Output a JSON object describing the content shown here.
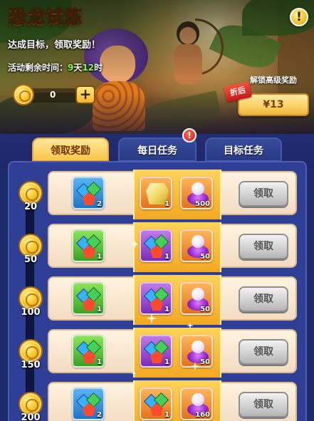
{
  "header": {
    "title": "恐龙试炼",
    "help_icon": "exclamation-icon",
    "help_label": "!",
    "subtitle": "达成目标，领取奖励！",
    "timer": {
      "prefix": "活动剩余时间：",
      "days": "9",
      "days_unit": "天",
      "hours": "12",
      "hours_unit": "时"
    },
    "coins": {
      "count": "0",
      "add_label": "+"
    },
    "unlock_label": "解锁高级奖励",
    "discount_tag": "折后",
    "price_label": "¥13"
  },
  "tabs": [
    {
      "label": "领取奖励",
      "active": true
    },
    {
      "label": "每日任务",
      "active": false,
      "badge": "!"
    },
    {
      "label": "目标任务",
      "active": false
    }
  ],
  "rewards": [
    {
      "milestone": "20",
      "free": {
        "icon": "gem-bundle-icon",
        "quality": "blue",
        "qty": "2"
      },
      "premium": [
        {
          "icon": "crystal-chest-icon",
          "quality": "orange",
          "qty": "1"
        },
        {
          "icon": "purple-orb-icon",
          "quality": "orange",
          "qty": "500"
        }
      ],
      "claim_label": "领取"
    },
    {
      "milestone": "50",
      "free": {
        "icon": "gem-bundle-icon",
        "quality": "green",
        "qty": "1"
      },
      "premium": [
        {
          "icon": "gem-bundle-icon",
          "quality": "purple",
          "qty": "1"
        },
        {
          "icon": "purple-orb-icon",
          "quality": "orange",
          "qty": "50"
        }
      ],
      "claim_label": "领取"
    },
    {
      "milestone": "100",
      "free": {
        "icon": "gem-bundle-icon",
        "quality": "green",
        "qty": "1"
      },
      "premium": [
        {
          "icon": "gem-bundle-icon",
          "quality": "purple",
          "qty": "1"
        },
        {
          "icon": "purple-orb-icon",
          "quality": "orange",
          "qty": "50"
        }
      ],
      "claim_label": "领取"
    },
    {
      "milestone": "150",
      "free": {
        "icon": "gem-bundle-icon",
        "quality": "green",
        "qty": "1"
      },
      "premium": [
        {
          "icon": "gem-bundle-icon",
          "quality": "purple",
          "qty": "1"
        },
        {
          "icon": "purple-orb-icon",
          "quality": "orange",
          "qty": "50"
        }
      ],
      "claim_label": "领取"
    },
    {
      "milestone": "200",
      "free": {
        "icon": "gem-bundle-icon",
        "quality": "blue",
        "qty": "2"
      },
      "premium": [
        {
          "icon": "gem-bundle-icon",
          "quality": "orange",
          "qty": "1"
        },
        {
          "icon": "purple-orb-icon",
          "quality": "orange",
          "qty": "160"
        }
      ],
      "claim_label": "领取"
    }
  ],
  "colors": {
    "background": "#1f2a6b",
    "title": "#ffe27a",
    "timer_number": "#7dff4a",
    "tab_active": "#f8c64a",
    "tab_idle": "#2a3a84",
    "premium_zone": "#f3a822",
    "discount_tag": "#c4181a"
  }
}
